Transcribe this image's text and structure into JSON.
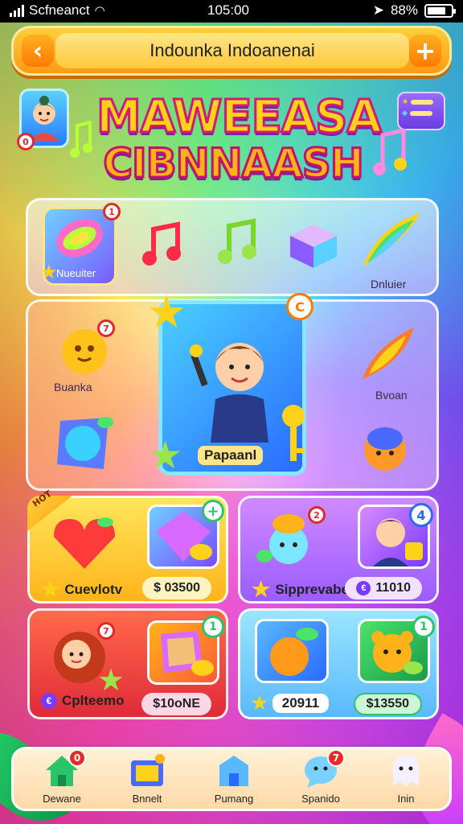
{
  "status_bar": {
    "carrier": "Scfneanct",
    "time": "105:00",
    "battery": "88%"
  },
  "top_bar": {
    "title": "Indounka Indoanenai",
    "back_icon": "chevron-left-icon",
    "add_icon": "plus-icon"
  },
  "header": {
    "avatar_badge": "0",
    "logo_line1": "MAWEEASA",
    "logo_line2": "CIBNNAASH"
  },
  "items_row": {
    "selected_item_label": "Nueuiter",
    "selected_badge": "1",
    "end_label": "Dnluier",
    "icons": [
      "leaf-gem-icon",
      "music-note-red-icon",
      "music-note-green-icon",
      "crystal-cube-icon",
      "rainbow-feather-icon"
    ]
  },
  "featured": {
    "left_top_label": "Buanka",
    "right_label": "Bvoan",
    "hero_label": "Papaanl",
    "hero_badge": "C",
    "left_badge": "7"
  },
  "cards": [
    {
      "tag": "HOT",
      "label": "Cuevlotv",
      "price": "$ 03500",
      "badge": "+"
    },
    {
      "label": "Sipprevaber",
      "price": "11010",
      "badge": "4",
      "badge2": "2"
    },
    {
      "label": "Cplteemo",
      "price": "$10oNE",
      "badge": "1",
      "badge2": "7"
    },
    {
      "label": "20911",
      "price": "$13550",
      "badge": "1"
    }
  ],
  "nav": [
    {
      "label": "Dewane",
      "icon": "home-icon",
      "badge": "0"
    },
    {
      "label": "Bnnelt",
      "icon": "shop-icon",
      "badge": ""
    },
    {
      "label": "Pumang",
      "icon": "building-icon",
      "badge": ""
    },
    {
      "label": "Spanido",
      "icon": "chat-icon",
      "badge": "7"
    },
    {
      "label": "Inin",
      "icon": "ghost-icon",
      "badge": ""
    }
  ],
  "colors": {
    "accent_orange": "#ff9a14",
    "gold": "#ffd21a",
    "magenta": "#d2197a",
    "badge_red": "#e82a2a"
  }
}
